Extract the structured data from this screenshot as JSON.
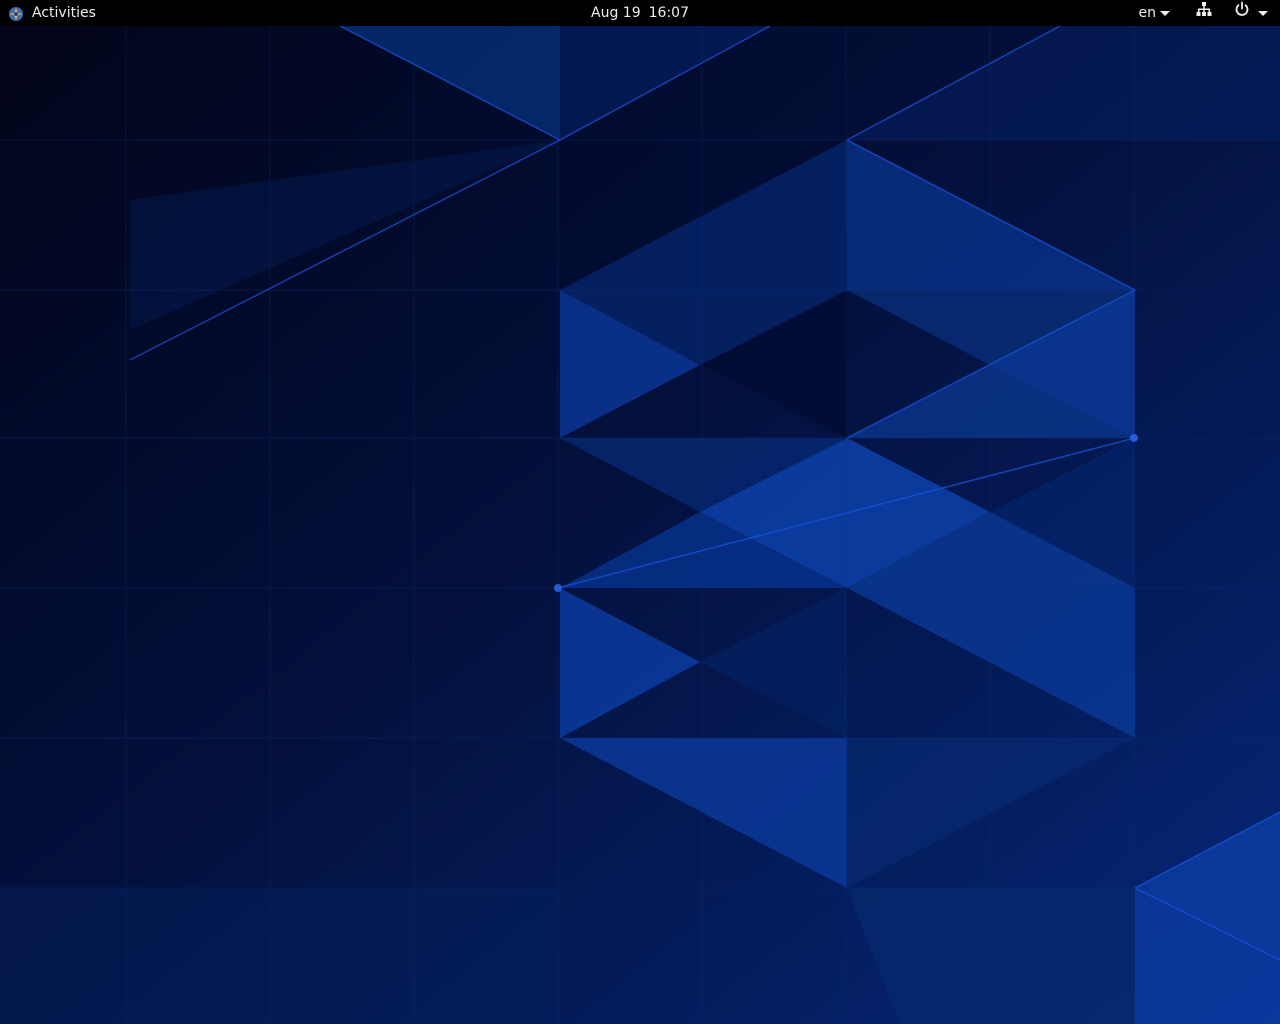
{
  "topbar": {
    "activities_label": "Activities",
    "clock": {
      "date": "Aug 19",
      "time": "16:07"
    },
    "language": "en"
  },
  "icons": {
    "activities": "fedora-logo-icon",
    "language_dropdown": "chevron-down-icon",
    "network": "network-wired-icon",
    "power": "power-icon",
    "system_menu_dropdown": "chevron-down-icon"
  },
  "colors": {
    "topbar_bg": "#000000",
    "topbar_text": "#eeeeec",
    "wallpaper_dark": "#020a2e",
    "wallpaper_mid": "#0a2a6e",
    "wallpaper_light": "#0a3a9a"
  }
}
